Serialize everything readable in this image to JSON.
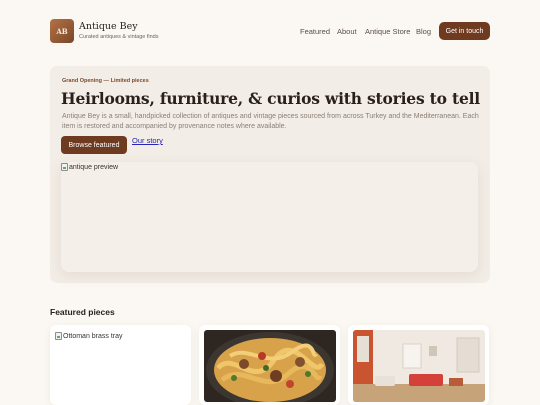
{
  "brand": {
    "initials": "AB",
    "name": "Antique Bey",
    "tagline": "Curated antiques & vintage finds"
  },
  "nav": {
    "links": [
      "Featured",
      "About",
      "Antique Store",
      "Blog"
    ],
    "cta": "Get in touch"
  },
  "hero": {
    "kicker": "Grand Opening — Limited pieces",
    "title": "Heirlooms, furniture, & curios with stories to tell",
    "text": "Antique Bey is a small, handpicked collection of antiques and vintage pieces sourced from across Turkey and the Mediterranean. Each item is restored and accompanied by provenance notes where available.",
    "primary_button": "Browse featured",
    "secondary_link": "Our story",
    "preview_alt": "antique preview"
  },
  "featured": {
    "title": "Featured pieces",
    "cards": [
      {
        "alt": "Ottoman brass tray",
        "image": "broken"
      },
      {
        "image": "pasta-dish-photo"
      },
      {
        "image": "interior-room-photo"
      }
    ]
  },
  "colors": {
    "accent": "#6e3a20",
    "background": "#fbf8f3",
    "hero_panel": "#f2ede6",
    "link": "#2a25b8"
  }
}
